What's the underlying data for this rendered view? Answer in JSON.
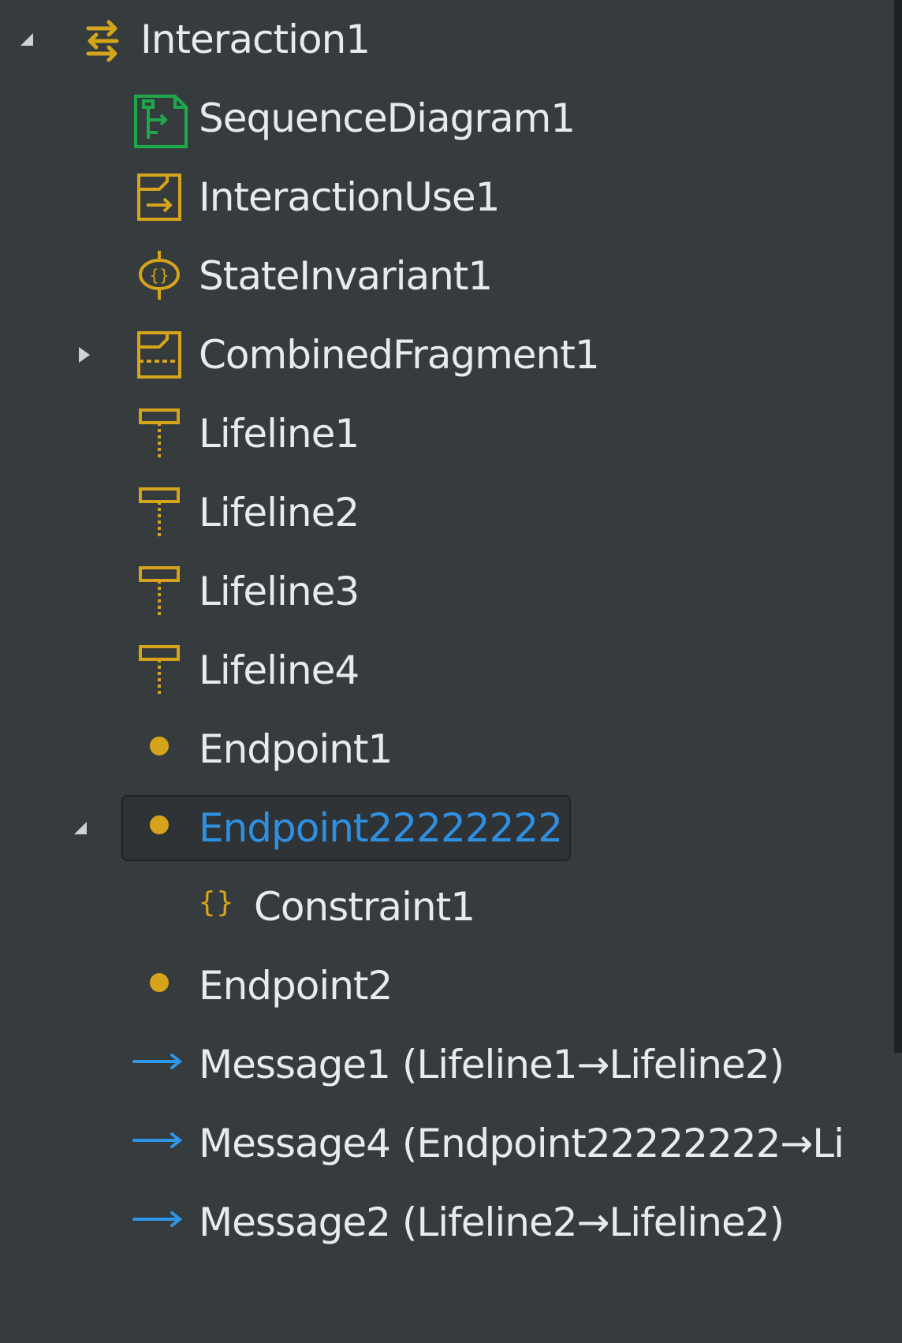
{
  "colors": {
    "background": "#363b3e",
    "text": "#e8eaec",
    "selected_text": "#2f8fe0",
    "icon_gold": "#d6a41a",
    "icon_green": "#1ea84c",
    "message_blue": "#2f96e8"
  },
  "tree": {
    "items": [
      {
        "label": "Interaction1",
        "icon": "interaction-icon",
        "expander": "expanded"
      },
      {
        "label": "SequenceDiagram1",
        "icon": "sequence-diagram-icon"
      },
      {
        "label": "InteractionUse1",
        "icon": "interaction-use-icon"
      },
      {
        "label": "StateInvariant1",
        "icon": "state-invariant-icon"
      },
      {
        "label": "CombinedFragment1",
        "icon": "combined-fragment-icon",
        "expander": "collapsed"
      },
      {
        "label": "Lifeline1",
        "icon": "lifeline-icon"
      },
      {
        "label": "Lifeline2",
        "icon": "lifeline-icon"
      },
      {
        "label": "Lifeline3",
        "icon": "lifeline-icon"
      },
      {
        "label": "Lifeline4",
        "icon": "lifeline-icon"
      },
      {
        "label": "Endpoint1",
        "icon": "endpoint-icon"
      },
      {
        "label": "Endpoint22222222",
        "icon": "endpoint-icon",
        "expander": "expanded",
        "selected": true
      },
      {
        "label": "Constraint1",
        "icon": "constraint-icon"
      },
      {
        "label": "Endpoint2",
        "icon": "endpoint-icon"
      },
      {
        "label": "Message1 (Lifeline1→Lifeline2)",
        "icon": "message-arrow-icon"
      },
      {
        "label": "Message4 (Endpoint22222222→Li",
        "icon": "message-arrow-icon"
      },
      {
        "label": "Message2 (Lifeline2→Lifeline2)",
        "icon": "message-arrow-icon"
      }
    ]
  }
}
